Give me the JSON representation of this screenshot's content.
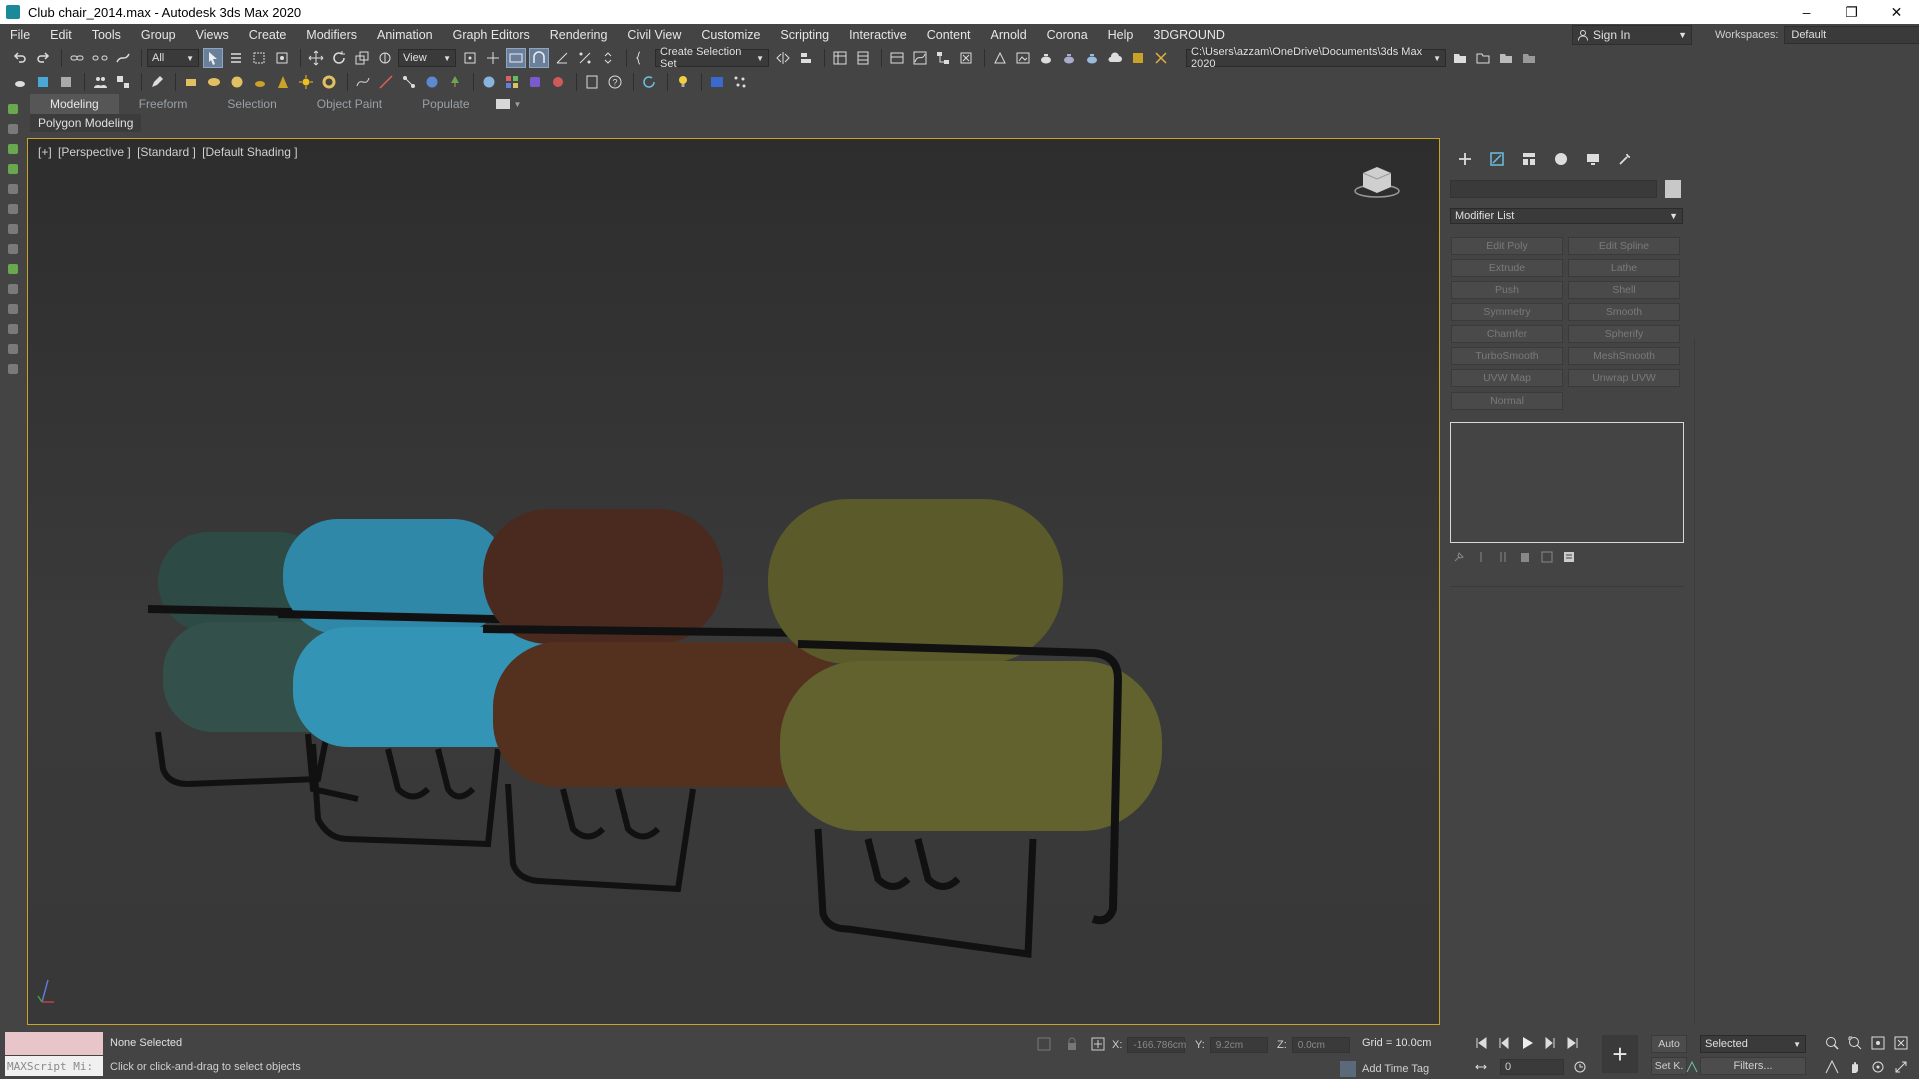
{
  "window": {
    "title": "Club chair_2014.max - Autodesk 3ds Max 2020",
    "min": "–",
    "max": "❐",
    "close": "✕"
  },
  "menu": [
    "File",
    "Edit",
    "Tools",
    "Group",
    "Views",
    "Create",
    "Modifiers",
    "Animation",
    "Graph Editors",
    "Rendering",
    "Civil View",
    "Customize",
    "Scripting",
    "Interactive",
    "Content",
    "Arnold",
    "Corona",
    "Help",
    "3DGROUND"
  ],
  "account": {
    "signin": "Sign In"
  },
  "workspaces": {
    "label": "Workspaces:",
    "value": "Default"
  },
  "toolbar1": {
    "filter": "All",
    "ref_coord": "View",
    "selection_set": "Create Selection Set",
    "project_path": "C:\\Users\\azzam\\OneDrive\\Documents\\3ds Max 2020"
  },
  "ribbon": {
    "tabs": [
      "Modeling",
      "Freeform",
      "Selection",
      "Object Paint",
      "Populate"
    ],
    "active_tab": "Modeling",
    "subpanel": "Polygon Modeling"
  },
  "viewport": {
    "labels": [
      "[+]",
      "[Perspective ]",
      "[Standard ]",
      "[Default Shading ]"
    ],
    "chair_colors": [
      "#2e4a45",
      "#2f88a8",
      "#4a2a1f",
      "#5a5a2a"
    ]
  },
  "command_panel": {
    "modifier_list": "Modifier List",
    "buttons": [
      "Edit Poly",
      "Edit Spline",
      "Extrude",
      "Lathe",
      "Push",
      "Shell",
      "Symmetry",
      "Smooth",
      "Chamfer",
      "Spherify",
      "TurboSmooth",
      "MeshSmooth",
      "UVW Map",
      "Unwrap UVW",
      "Normal"
    ]
  },
  "status": {
    "maxscript": "MAXScript Mi:",
    "selection": "None Selected",
    "prompt": "Click or click-and-drag to select objects",
    "x_label": "X:",
    "x_value": "-166.786cm",
    "y_label": "Y:",
    "y_value": "9.2cm",
    "z_label": "Z:",
    "z_value": "0.0cm",
    "grid": "Grid = 10.0cm",
    "add_time_tag": "Add Time Tag",
    "frame": "0",
    "auto": "Auto",
    "set_key": "Set K.",
    "key_filter": "Selected",
    "filters": "Filters..."
  }
}
